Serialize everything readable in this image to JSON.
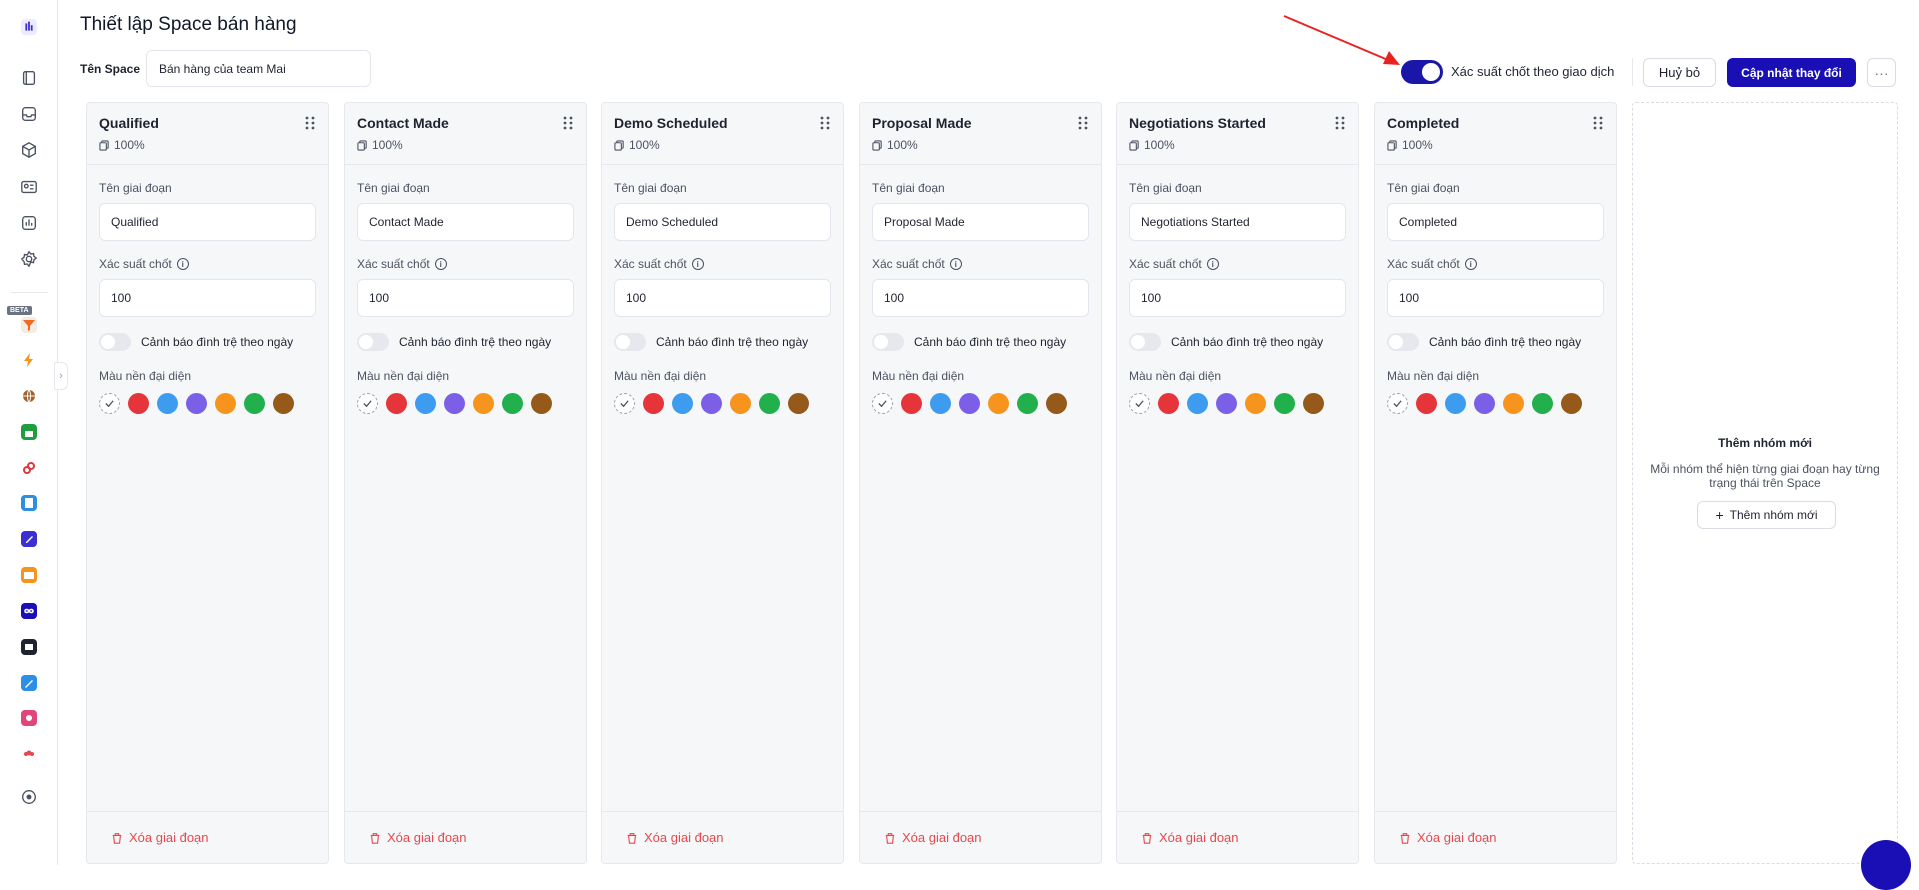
{
  "header": {
    "title": "Thiết lập Space bán hàng",
    "space_label": "Tên Space",
    "space_value": "Bán hàng của team Mai",
    "toggle_label": "Xác suất chốt theo giao dịch",
    "cancel_label": "Huỷ bỏ",
    "save_label": "Cập nhật thay đổi",
    "more_label": "···"
  },
  "rail": {
    "beta_label": "BETA",
    "collapse_glyph": "›"
  },
  "stage_labels": {
    "name_label": "Tên giai đoạn",
    "prob_label": "Xác suất chốt",
    "stale_label": "Cảnh báo đình trệ theo ngày",
    "color_label": "Màu nền đại diện",
    "delete_label": "Xóa giai đoạn"
  },
  "stages": [
    {
      "title": "Qualified",
      "percent": "100%",
      "name": "Qualified",
      "probability": "100"
    },
    {
      "title": "Contact Made",
      "percent": "100%",
      "name": "Contact Made",
      "probability": "100"
    },
    {
      "title": "Demo Scheduled",
      "percent": "100%",
      "name": "Demo Scheduled",
      "probability": "100"
    },
    {
      "title": "Proposal Made",
      "percent": "100%",
      "name": "Proposal Made",
      "probability": "100"
    },
    {
      "title": "Negotiations Started",
      "percent": "100%",
      "name": "Negotiations Started",
      "probability": "100"
    },
    {
      "title": "Completed",
      "percent": "100%",
      "name": "Completed",
      "probability": "100"
    }
  ],
  "swatch_colors": [
    "#e5353b",
    "#3d9cf0",
    "#7b5fe6",
    "#f7941d",
    "#21b04b",
    "#95591a"
  ],
  "add_group": {
    "title": "Thêm nhóm mới",
    "description": "Mỗi nhóm thể hiện từng giai đoạn hay từng trạng thái trên Space",
    "button_label": "Thêm nhóm mới"
  },
  "colors": {
    "primary": "#1a0fb4",
    "danger": "#e5484d",
    "annotation_arrow": "#e8231f"
  }
}
